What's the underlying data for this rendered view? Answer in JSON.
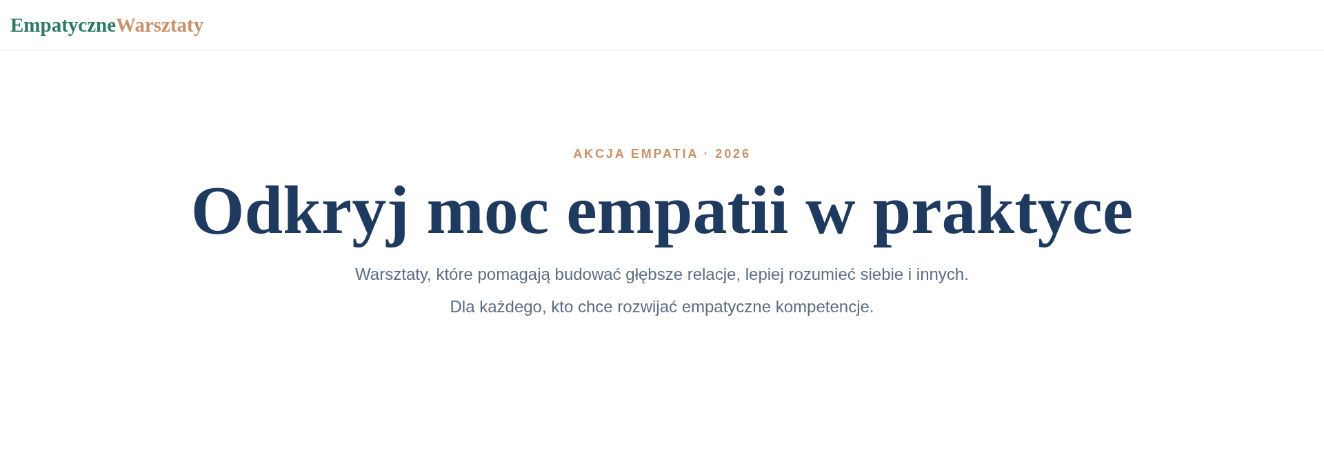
{
  "header": {
    "logo": [
      {
        "text": "Empatyczne",
        "color": "#2b7a68"
      },
      {
        "text": "Warsztaty",
        "color": "#c8926a"
      }
    ]
  },
  "hero": {
    "eyebrow": "AKCJA EMPATIA · 2026",
    "title": "Odkryj moc empatii w praktyce",
    "subtitle": "Warsztaty, które pomagają budować głębsze relacje, lepiej rozumieć siebie i innych. Dla każdego, kto chce rozwijać empatyczne kompetencje."
  }
}
